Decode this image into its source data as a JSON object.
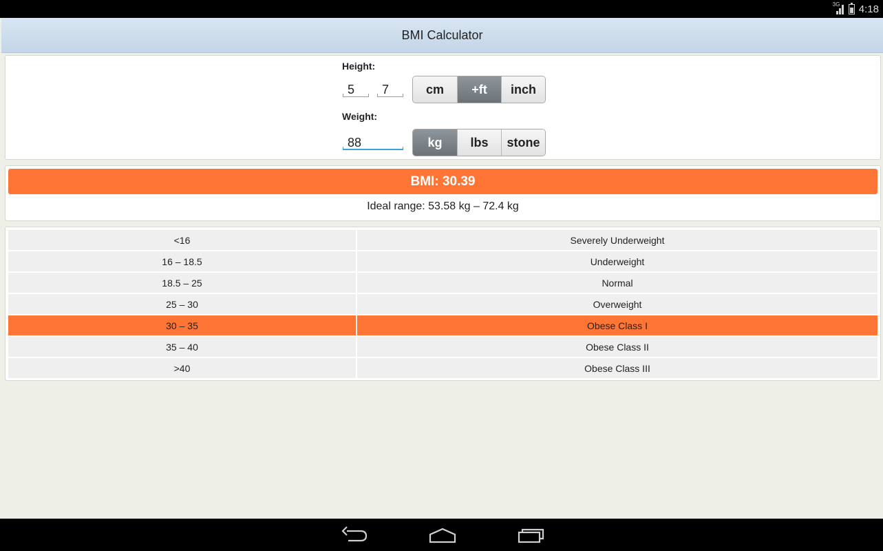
{
  "status_bar": {
    "time": "4:18",
    "network": "3G"
  },
  "app": {
    "title": "BMI Calculator"
  },
  "height": {
    "label": "Height:",
    "feet": "5",
    "inches": "7",
    "units": [
      "cm",
      "+ft",
      "inch"
    ],
    "selected_unit": "+ft"
  },
  "weight": {
    "label": "Weight:",
    "value": "88",
    "units": [
      "kg",
      "lbs",
      "stone"
    ],
    "selected_unit": "kg"
  },
  "result": {
    "bmi_text": "BMI: 30.39",
    "ideal_range": "Ideal range: 53.58 kg – 72.4 kg",
    "highlight_color": "#ff7536"
  },
  "categories": [
    {
      "range": "<16",
      "name": "Severely Underweight"
    },
    {
      "range": "16 – 18.5",
      "name": "Underweight"
    },
    {
      "range": "18.5 – 25",
      "name": "Normal"
    },
    {
      "range": "25 – 30",
      "name": "Overweight"
    },
    {
      "range": "30 – 35",
      "name": "Obese Class I"
    },
    {
      "range": "35 – 40",
      "name": "Obese Class II"
    },
    {
      "range": ">40",
      "name": "Obese Class III"
    }
  ],
  "selected_category_index": 4,
  "nav": {
    "icons": [
      "back-icon",
      "home-icon",
      "recent-apps-icon"
    ]
  }
}
